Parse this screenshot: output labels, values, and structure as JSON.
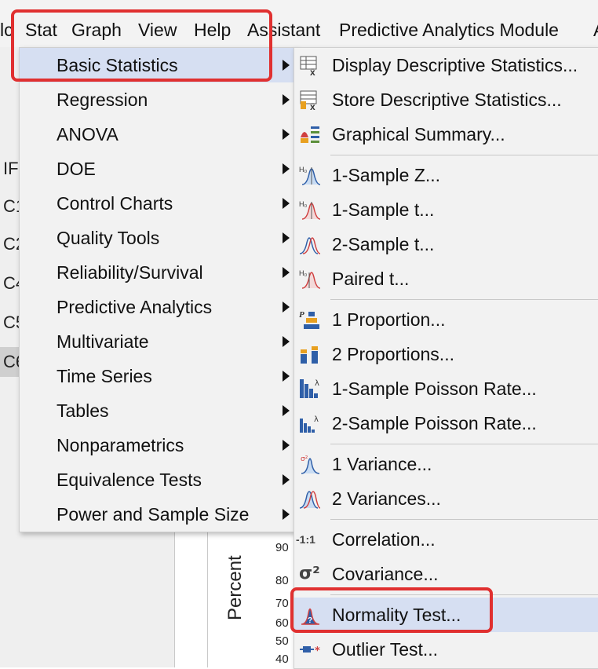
{
  "menubar": {
    "items": [
      "lc",
      "Stat",
      "Graph",
      "View",
      "Help",
      "Assistant",
      "Predictive Analytics Module",
      "A"
    ]
  },
  "left_panel": {
    "rows": [
      "IFI",
      "C1",
      "C2",
      "C4",
      "C5",
      "C6"
    ]
  },
  "graph": {
    "ticks": [
      "90",
      "80",
      "70",
      "60",
      "50",
      "40"
    ],
    "ylabel": "Percent"
  },
  "main_menu": {
    "items": [
      {
        "label": "Basic Statistics",
        "submenu": true,
        "highlighted": true
      },
      {
        "label": "Regression",
        "submenu": true
      },
      {
        "label": "ANOVA",
        "submenu": true
      },
      {
        "label": "DOE",
        "submenu": true
      },
      {
        "label": "Control Charts",
        "submenu": true
      },
      {
        "label": "Quality Tools",
        "submenu": true
      },
      {
        "label": "Reliability/Survival",
        "submenu": true
      },
      {
        "label": "Predictive Analytics",
        "submenu": true
      },
      {
        "label": "Multivariate",
        "submenu": true
      },
      {
        "label": "Time Series",
        "submenu": true
      },
      {
        "label": "Tables",
        "submenu": true
      },
      {
        "label": "Nonparametrics",
        "submenu": true
      },
      {
        "label": "Equivalence Tests",
        "submenu": true
      },
      {
        "label": "Power and Sample Size",
        "submenu": true
      }
    ]
  },
  "sub_menu": {
    "items": [
      {
        "label": "Display Descriptive Statistics...",
        "icon": "display-descriptive-stats-icon"
      },
      {
        "label": "Store Descriptive Statistics...",
        "icon": "store-descriptive-stats-icon"
      },
      {
        "label": "Graphical Summary...",
        "icon": "graphical-summary-icon"
      },
      {
        "label": "1-Sample Z...",
        "icon": "one-sample-z-icon"
      },
      {
        "label": "1-Sample t...",
        "icon": "one-sample-t-icon"
      },
      {
        "label": "2-Sample t...",
        "icon": "two-sample-t-icon"
      },
      {
        "label": "Paired t...",
        "icon": "paired-t-icon"
      },
      {
        "label": "1 Proportion...",
        "icon": "one-proportion-icon"
      },
      {
        "label": "2 Proportions...",
        "icon": "two-proportions-icon"
      },
      {
        "label": "1-Sample Poisson Rate...",
        "icon": "one-sample-poisson-icon"
      },
      {
        "label": "2-Sample Poisson Rate...",
        "icon": "two-sample-poisson-icon"
      },
      {
        "label": "1 Variance...",
        "icon": "one-variance-icon"
      },
      {
        "label": "2 Variances...",
        "icon": "two-variances-icon"
      },
      {
        "label": "Correlation...",
        "icon": "correlation-icon",
        "icon_text": "-1:1"
      },
      {
        "label": "Covariance...",
        "icon": "covariance-icon",
        "icon_text": "σ²"
      },
      {
        "label": "Normality Test...",
        "icon": "normality-test-icon",
        "highlighted": true
      },
      {
        "label": "Outlier Test...",
        "icon": "outlier-test-icon"
      }
    ]
  },
  "colors": {
    "highlight": "#d6dff2",
    "annotation_red": "#e03030",
    "icon_blue": "#2f5fa8",
    "icon_orange": "#e8a020",
    "icon_red": "#d04040"
  }
}
